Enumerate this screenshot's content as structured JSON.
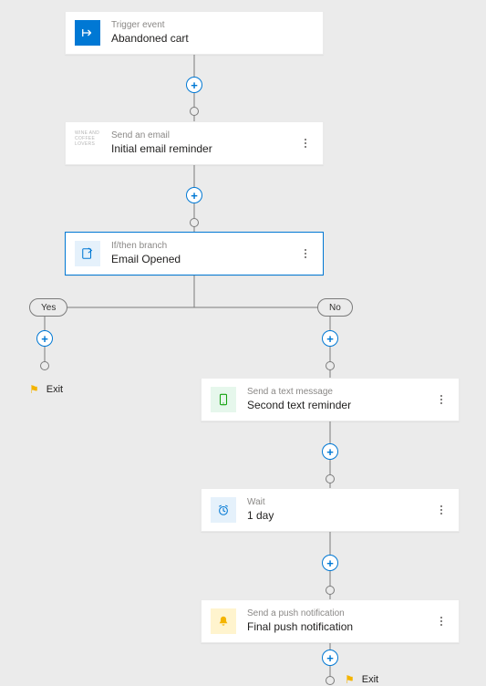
{
  "trigger": {
    "type_label": "Trigger event",
    "name": "Abandoned cart"
  },
  "email": {
    "type_label": "Send an email",
    "name": "Initial email reminder"
  },
  "branch": {
    "type_label": "If/then branch",
    "name": "Email Opened"
  },
  "branch_labels": {
    "yes": "Yes",
    "no": "No"
  },
  "sms": {
    "type_label": "Send a text message",
    "name": "Second text reminder"
  },
  "wait": {
    "type_label": "Wait",
    "name": "1 day"
  },
  "push": {
    "type_label": "Send a push notification",
    "name": "Final push notification"
  },
  "exit_label": "Exit"
}
